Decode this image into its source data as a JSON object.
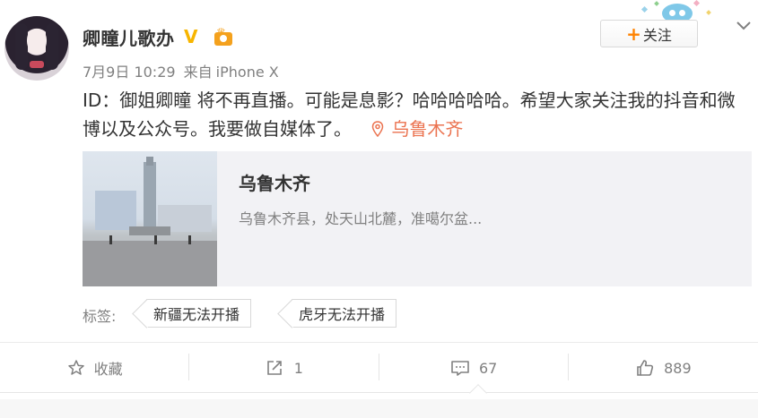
{
  "post": {
    "author_name": "卿瞳儿歌办",
    "verified_mark": "V",
    "time": "7月9日 10:29",
    "source_prefix": "来自",
    "source_device": "iPhone X",
    "text": "ID：御姐卿瞳 将不再直播。可能是息影？哈哈哈哈哈。希望大家关注我的抖音和微博以及公众号。我要做自媒体了。",
    "location_inline": "乌鲁木齐"
  },
  "follow": {
    "label": "关注"
  },
  "location_card": {
    "title": "乌鲁木齐",
    "description": "乌鲁木齐县，处天山北麓，准噶尔盆..."
  },
  "tags": {
    "label": "标签:",
    "items": [
      "新疆无法开播",
      "虎牙无法开播"
    ]
  },
  "actions": {
    "favorite": "收藏",
    "repost": "1",
    "comment": "67",
    "like": "889"
  },
  "colors": {
    "accent_orange": "#ff8200",
    "location_red": "#eb7350",
    "verified_gold": "#f7b500"
  },
  "icons": [
    "star-icon",
    "repost-icon",
    "comment-icon",
    "thumbs-up-icon",
    "location-pin-icon",
    "chevron-down-icon",
    "vip-badge-icon"
  ]
}
